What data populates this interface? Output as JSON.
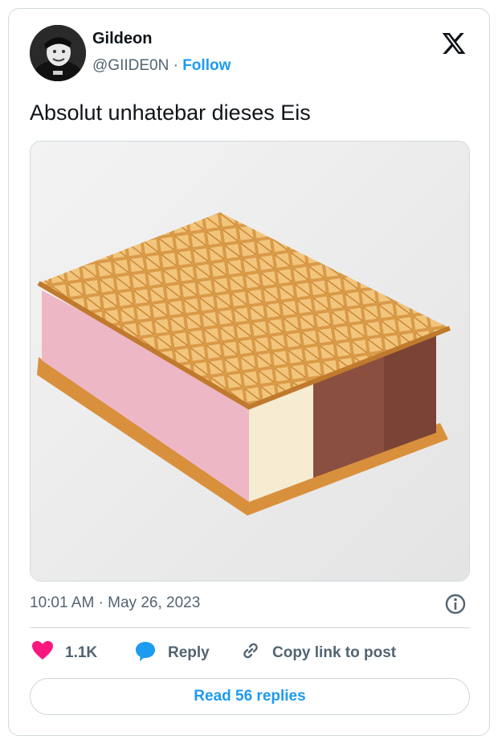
{
  "author": {
    "name": "Gildeon",
    "handle": "@GIIDE0N",
    "separator": "·",
    "follow_label": "Follow"
  },
  "tweet": {
    "text": "Absolut unhatebar dieses Eis",
    "timestamp": "10:01 AM · May 26, 2023"
  },
  "actions": {
    "like_count": "1.1K",
    "reply_label": "Reply",
    "copy_link_label": "Copy link to post"
  },
  "read_replies_label": "Read 56 replies",
  "icons": {
    "brand": "x-logo-icon",
    "info": "info-icon",
    "like": "heart-icon",
    "reply": "speech-bubble-icon",
    "copy": "link-icon"
  },
  "colors": {
    "accent": "#1d9bf0",
    "like": "#f91880",
    "muted": "#536471",
    "border": "#cfd9de",
    "text": "#0f1419"
  }
}
